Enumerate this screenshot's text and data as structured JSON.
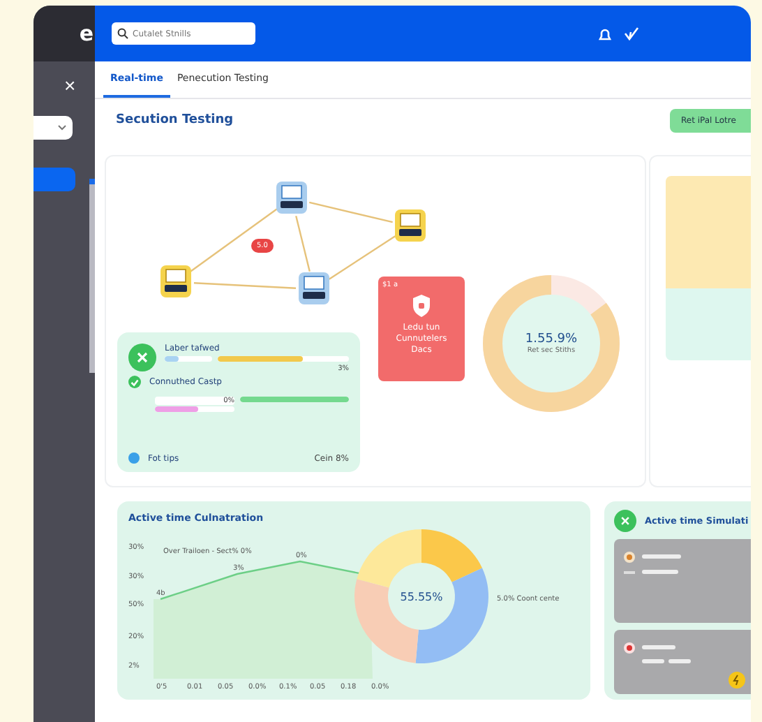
{
  "sidebar": {
    "logo": "e",
    "close": "×"
  },
  "header": {
    "search": {
      "placeholder": "Cutalet Stnills"
    }
  },
  "tabs": [
    {
      "label": "Real-time",
      "selected": true
    },
    {
      "label": "Penecution Testing",
      "selected": false
    }
  ],
  "title": "Secution Testing",
  "action_button": "Ret iPal Lotre",
  "network": {
    "badge": "5.0"
  },
  "status_card": {
    "rows": [
      {
        "kind": "progress",
        "label": "Laber tafwed",
        "bars": [
          {
            "color": "#a9d3f2",
            "level": 0.3
          },
          {
            "color": "#f2c94c",
            "level": 0.65
          }
        ],
        "reading": "3%"
      },
      {
        "kind": "check",
        "label": "Connuthed Castp",
        "checked": true,
        "bars": [
          {
            "color": "#ee9fe6",
            "level": 0.55
          },
          {
            "color": "#74d98f",
            "level": 1
          }
        ],
        "reading": "0%"
      },
      {
        "kind": "dot",
        "label": "Fot tips",
        "color": "#3aa0e8",
        "reading": "Cein 8%"
      }
    ]
  },
  "alert_card": {
    "corner": "$1 a",
    "text": "Ledu tun Cunnutelers Dacs"
  },
  "donut": {
    "value": "1.55.9%",
    "caption": "Ret sec Stiths",
    "level": 0.85
  },
  "bottom_chart": {
    "title": "Active time Culnatration",
    "legend": "Over Trailoen - Sect% 0%",
    "y_labels": [
      "30%",
      "30%",
      "50%",
      "20%",
      "2%"
    ],
    "x_labels": [
      "0'5",
      "0.01",
      "0.05",
      "0.0%",
      "0.1%",
      "0.05",
      "0.18",
      "0.0%"
    ],
    "point_labels": [
      "4b",
      "3%",
      "0%"
    ],
    "donut_value": "55.55%",
    "donut_legend": "5.0% Coont cente"
  },
  "simulation": {
    "title": "Active time Simulati"
  }
}
